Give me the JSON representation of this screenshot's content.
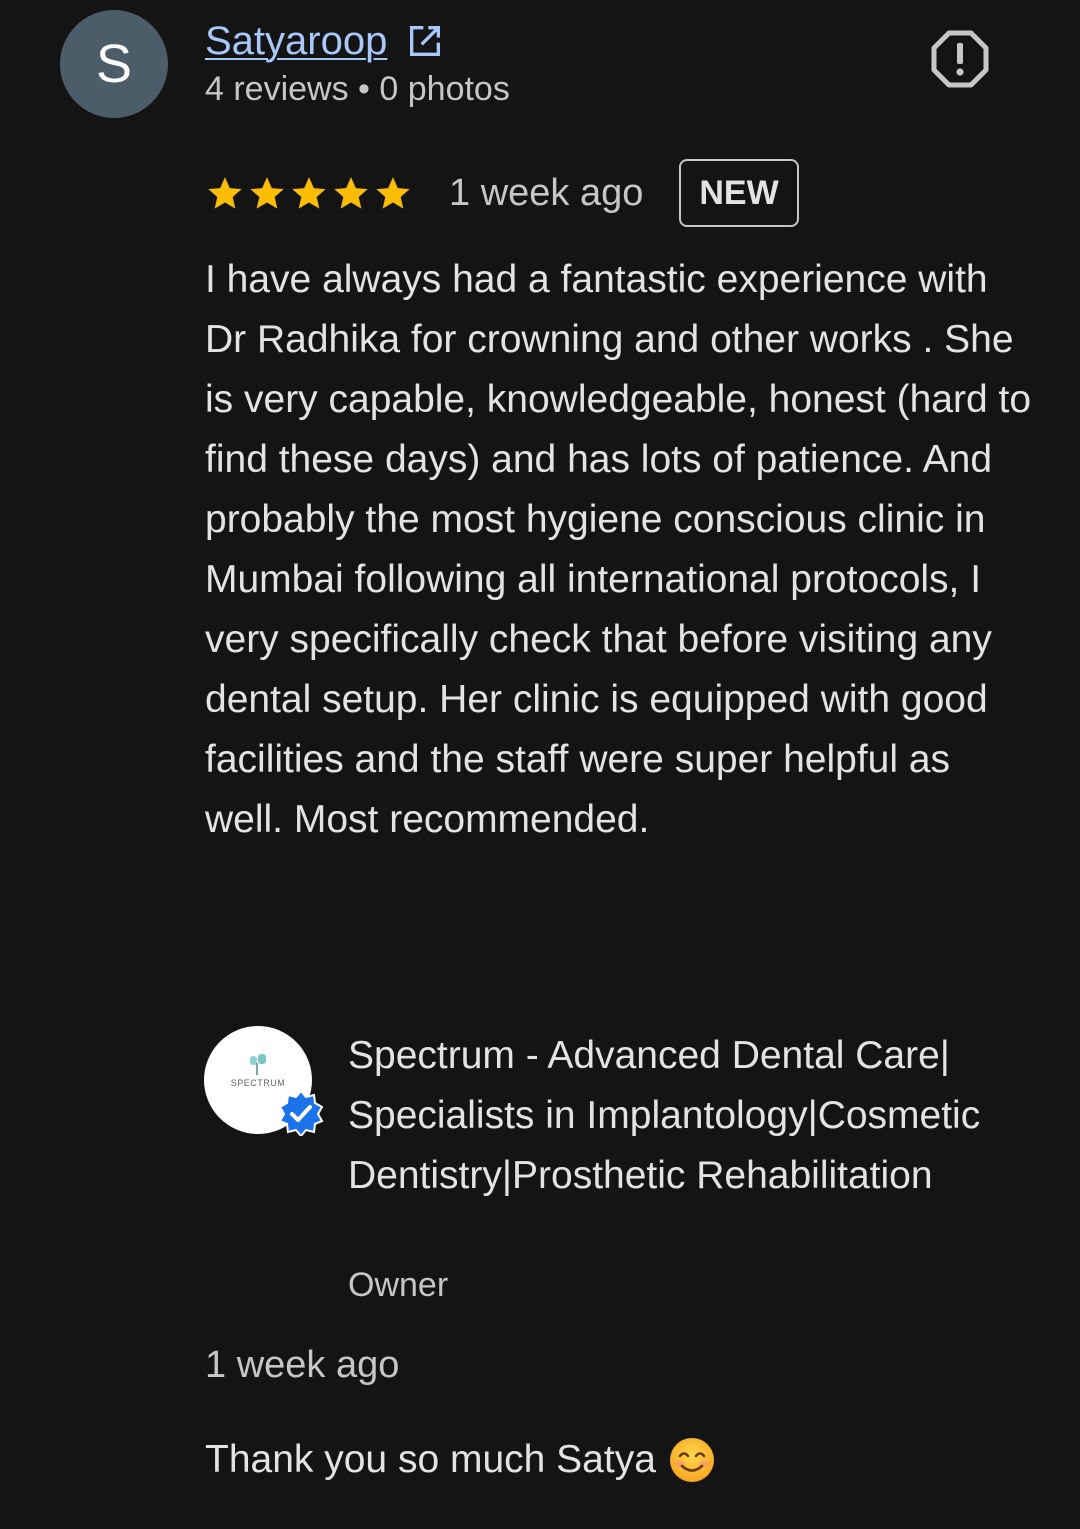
{
  "reviewer": {
    "initial": "S",
    "name": "Satyaroop",
    "meta": "4 reviews • 0 photos",
    "avatar_color": "#4a5d68"
  },
  "review": {
    "rating": 5,
    "date": "1 week ago",
    "badge": "NEW",
    "text": "I have always had a fantastic experience with Dr Radhika for crowning and other works . She is very capable, knowledgeable, honest (hard to find these days) and has lots of patience. And probably the most hygiene conscious clinic in Mumbai following all international protocols, I very specifically check that before visiting any dental setup. Her clinic is equipped with good facilities and the staff were super helpful as well. Most recommended.",
    "star_color": "#fbbc04"
  },
  "owner_reply": {
    "logo_text": "SPECTRUM",
    "name": "Spectrum - Advanced Dental Care| Specialists in Implantology|Cosmetic Dentistry|Prosthetic Rehabilitation",
    "role": "Owner",
    "date": "1 week ago",
    "text": "Thank you so much Satya",
    "verified_color": "#1a73e8"
  },
  "icons": {
    "external": "external-link-icon",
    "report": "report-flag-icon",
    "star": "star-icon",
    "verified": "verified-badge-icon",
    "emoji": "smiling-face-emoji-icon"
  },
  "colors": {
    "background": "#141414",
    "link": "#a8c7fa"
  }
}
